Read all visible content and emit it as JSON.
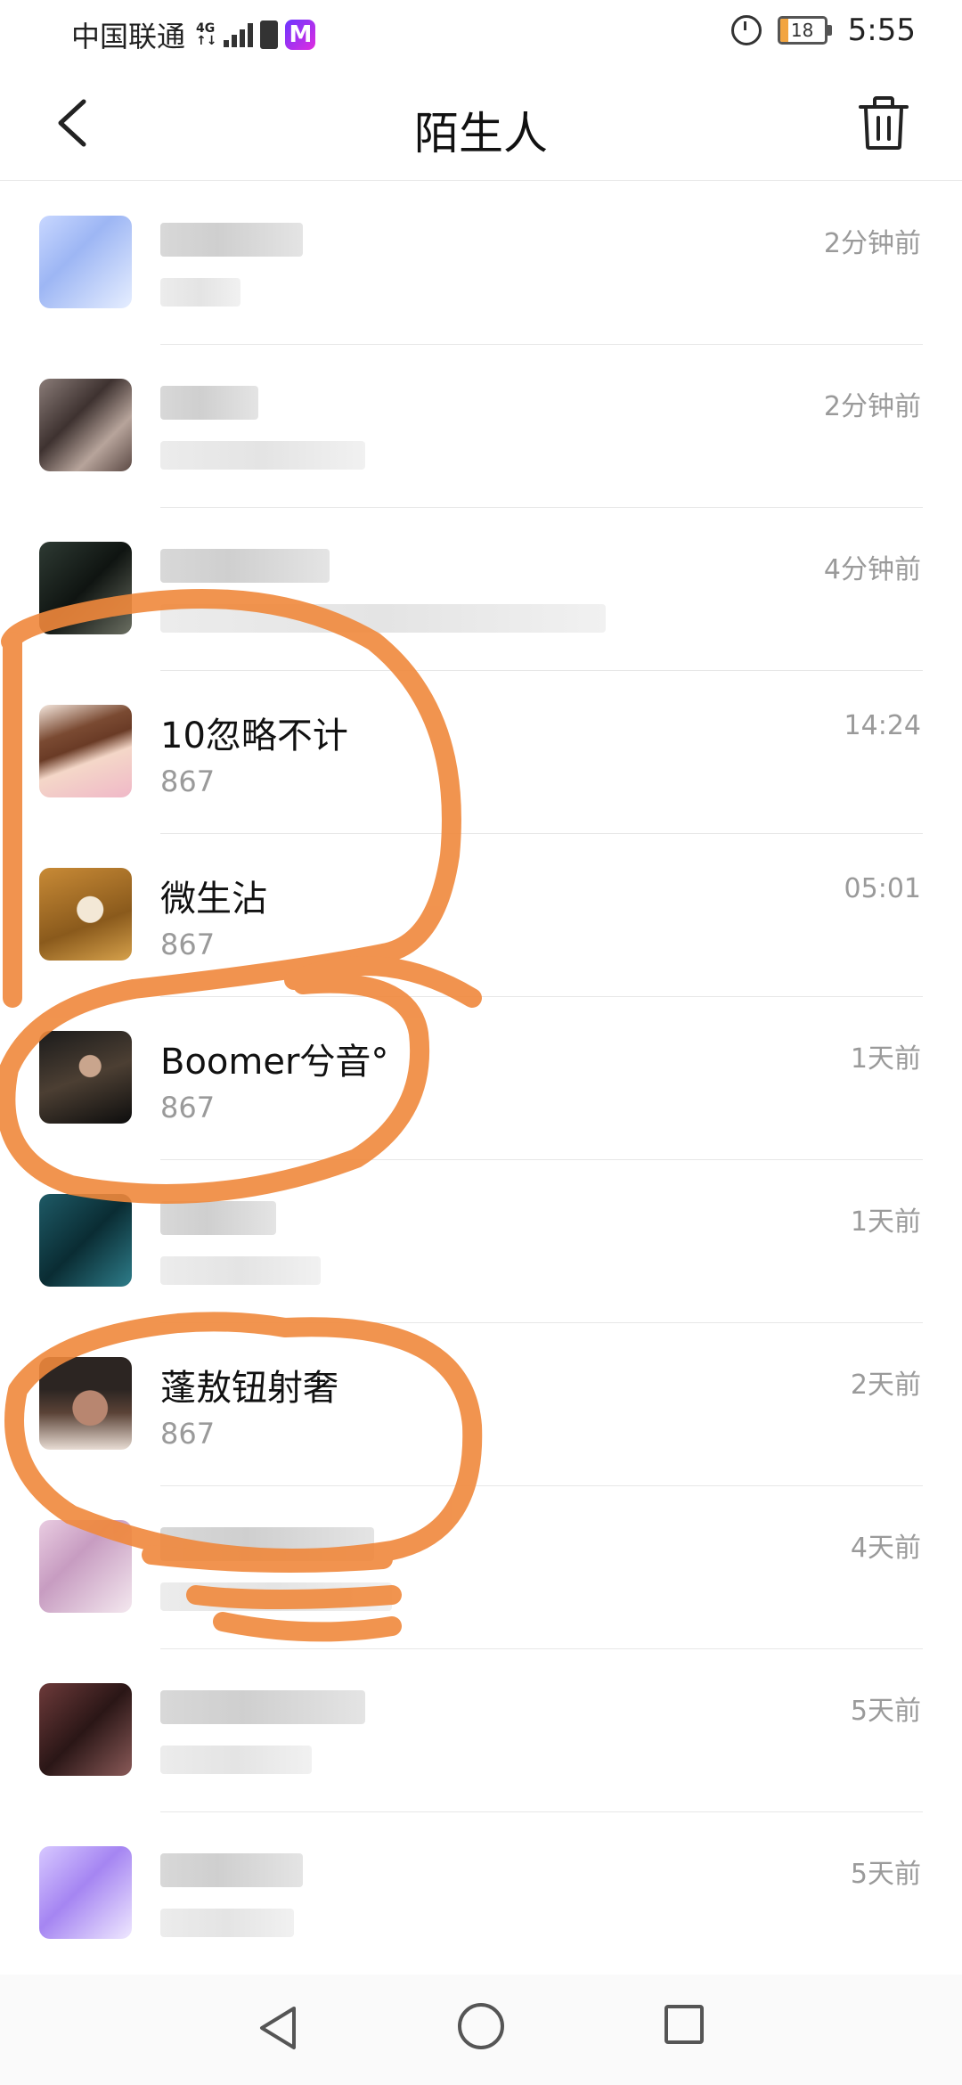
{
  "status_bar": {
    "carrier": "中国联通",
    "network": "4G",
    "app_icon_letter": "M",
    "battery_level": "18",
    "battery_percent": 18,
    "time": "5:55"
  },
  "header": {
    "title": "陌生人"
  },
  "conversations": [
    {
      "name": "",
      "preview": "",
      "time": "2分钟前",
      "blurred": true,
      "avatar": "px-blue"
    },
    {
      "name": "",
      "preview": "",
      "time": "2分钟前",
      "blurred": true,
      "avatar": "px-brown"
    },
    {
      "name": "",
      "preview": "",
      "time": "4分钟前",
      "blurred": true,
      "avatar": "px-dark"
    },
    {
      "name": "10忽略不计",
      "preview": "867",
      "time": "14:24",
      "blurred": false,
      "avatar": "av-anime1"
    },
    {
      "name": "微生沾",
      "preview": "867",
      "time": "05:01",
      "blurred": false,
      "avatar": "av-anime2"
    },
    {
      "name": "Boomer兮音°",
      "preview": "867",
      "time": "1天前",
      "blurred": false,
      "avatar": "av-dark"
    },
    {
      "name": "",
      "preview": "",
      "time": "1天前",
      "blurred": true,
      "avatar": "px-teal"
    },
    {
      "name": "蓬敖钮射奢",
      "preview": "867",
      "time": "2天前",
      "blurred": false,
      "avatar": "av-man"
    },
    {
      "name": "",
      "preview": "",
      "time": "4天前",
      "blurred": true,
      "avatar": "px-pink"
    },
    {
      "name": "",
      "preview": "",
      "time": "5天前",
      "blurred": true,
      "avatar": "px-maroon"
    },
    {
      "name": "",
      "preview": "",
      "time": "5天前",
      "blurred": true,
      "avatar": "px-lav"
    }
  ],
  "colors": {
    "annotation": "#f0883c",
    "secondary_text": "#9a9a9a",
    "divider": "#e7e7e7"
  },
  "icons": {
    "back": "chevron-left-icon",
    "trash": "trash-icon",
    "nav_back": "triangle-back-icon",
    "nav_home": "circle-home-icon",
    "nav_recent": "square-recent-icon"
  }
}
